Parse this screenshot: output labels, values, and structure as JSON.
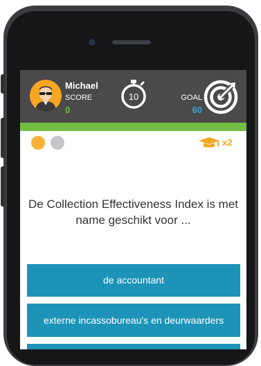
{
  "player": {
    "name": "Michael",
    "score_label": "SCORE",
    "score": "0"
  },
  "timer": {
    "value": "10"
  },
  "goal": {
    "label": "GOAL",
    "value": "60"
  },
  "progress": {
    "current_question": 1,
    "total_questions": 2
  },
  "multiplier": {
    "label": "x2",
    "icon": "graduation-cap-icon"
  },
  "question": {
    "text": "De Collection Effectiveness Index is met name geschikt voor ..."
  },
  "answers": [
    {
      "label": "de accountant"
    },
    {
      "label": "externe incassobureau's en deurwaarders"
    },
    {
      "label": ""
    }
  ],
  "colors": {
    "topbar": "#4a4a4a",
    "accent_green": "#72bf44",
    "goal_blue": "#3ba3d0",
    "answer_blue": "#1d93b8",
    "multiplier_gold": "#f5a623"
  }
}
